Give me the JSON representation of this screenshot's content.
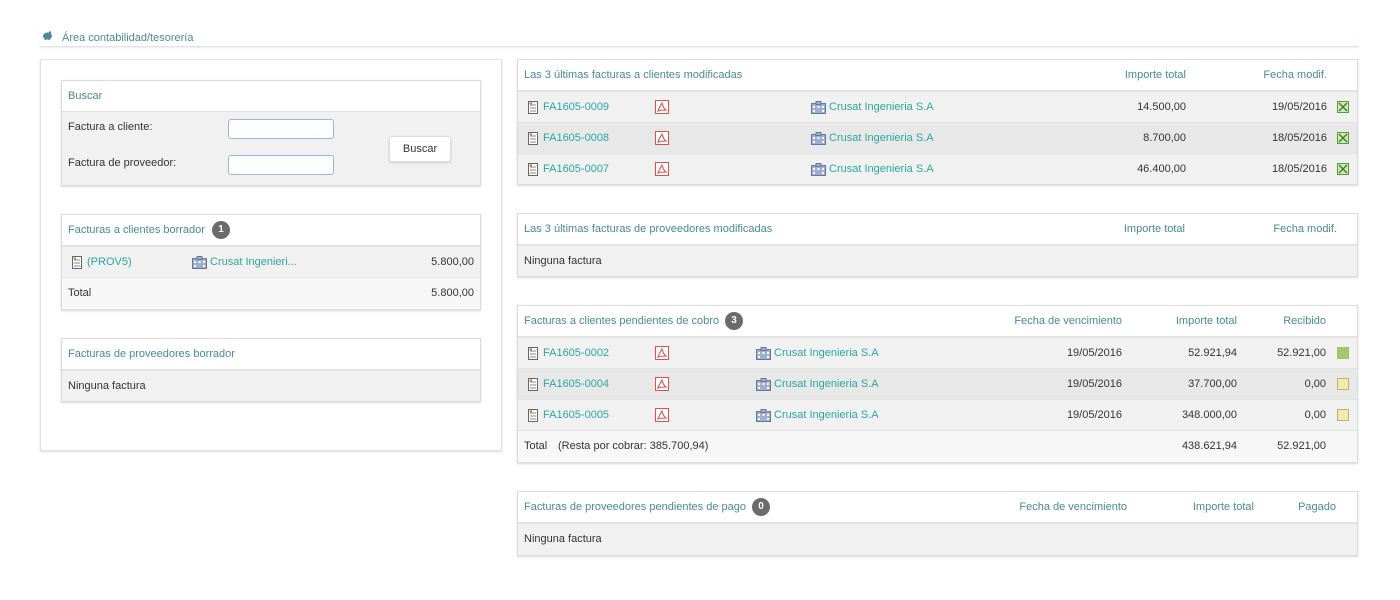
{
  "header": {
    "title": "Área contabilidad/tesorería",
    "icon": "piggy-bank-icon"
  },
  "search": {
    "title": "Buscar",
    "client_label": "Factura a cliente:",
    "supplier_label": "Factura de proveedor:",
    "client_value": "",
    "supplier_value": "",
    "button": "Buscar"
  },
  "draft_clients": {
    "title": "Facturas a clientes borrador",
    "count": "1",
    "rows": [
      {
        "ref": "(PROV5)",
        "company": "Crusat Ingenieri...",
        "amount": "5.800,00"
      }
    ],
    "total_label": "Total",
    "total": "5.800,00"
  },
  "draft_suppliers": {
    "title": "Facturas de proveedores borrador",
    "empty": "Ninguna factura"
  },
  "last_clients": {
    "title": "Las 3 últimas facturas a clientes modificadas",
    "col_amount": "Importe total",
    "col_date": "Fecha modif.",
    "rows": [
      {
        "ref": "FA1605-0009",
        "company": "Crusat Ingenieria S.A",
        "amount": "14.500,00",
        "date": "19/05/2016"
      },
      {
        "ref": "FA1605-0008",
        "company": "Crusat Ingenieria S.A",
        "amount": "8.700,00",
        "date": "18/05/2016"
      },
      {
        "ref": "FA1605-0007",
        "company": "Crusat Ingenieria S.A",
        "amount": "46.400,00",
        "date": "18/05/2016"
      }
    ]
  },
  "last_suppliers": {
    "title": "Las 3 últimas facturas de proveedores modificadas",
    "col_amount": "Importe total",
    "col_date": "Fecha modif.",
    "empty": "Ninguna factura"
  },
  "pending_clients": {
    "title": "Facturas a clientes pendientes de cobro",
    "count": "3",
    "col_due": "Fecha de vencimiento",
    "col_amount": "Importe total",
    "col_received": "Recibido",
    "rows": [
      {
        "ref": "FA1605-0002",
        "company": "Crusat Ingenieria S.A",
        "due": "19/05/2016",
        "amount": "52.921,94",
        "received": "52.921,00",
        "status_color": "#9acd6a"
      },
      {
        "ref": "FA1605-0004",
        "company": "Crusat Ingenieria S.A",
        "due": "19/05/2016",
        "amount": "37.700,00",
        "received": "0,00",
        "status_color": "#f3eba8"
      },
      {
        "ref": "FA1605-0005",
        "company": "Crusat Ingenieria S.A",
        "due": "19/05/2016",
        "amount": "348.000,00",
        "received": "0,00",
        "status_color": "#f3eba8"
      }
    ],
    "total_label": "Total",
    "total_note": "(Resta por cobrar: 385.700,94)",
    "total_amount": "438.621,94",
    "total_received": "52.921,00"
  },
  "pending_suppliers": {
    "title": "Facturas de proveedores pendientes de pago",
    "count": "0",
    "col_due": "Fecha de vencimiento",
    "col_amount": "Importe total",
    "col_paid": "Pagado",
    "empty": "Ninguna factura"
  },
  "colors": {
    "accent": "#2aa7a0",
    "heading": "#4b8a96",
    "badge": "#6b6b6b"
  }
}
